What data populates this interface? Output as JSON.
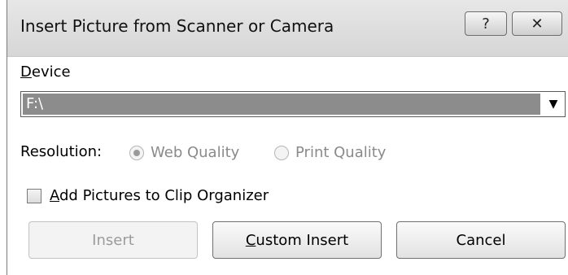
{
  "window": {
    "title": "Insert Picture from Scanner or Camera",
    "help_glyph": "?",
    "close_glyph": "✕"
  },
  "device": {
    "label_accel": "D",
    "label_rest": "evice",
    "selected_value": "F:\\",
    "arrow_glyph": "▼"
  },
  "resolution": {
    "label": "Resolution:",
    "options": [
      {
        "label": "Web Quality",
        "selected": true,
        "enabled": false
      },
      {
        "label": "Print Quality",
        "selected": false,
        "enabled": false
      }
    ]
  },
  "clip_organizer": {
    "label_accel": "A",
    "label_rest": "dd Pictures to Clip Organizer",
    "checked": false
  },
  "buttons": {
    "insert": "Insert",
    "custom_insert_accel": "C",
    "custom_insert_rest": "ustom Insert",
    "cancel": "Cancel"
  }
}
